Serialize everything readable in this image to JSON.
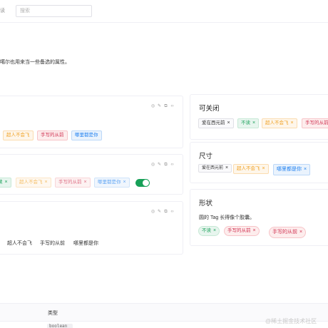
{
  "topbar": {
    "partial_text": "读",
    "search_placeholder": "搜索"
  },
  "intro": {
    "text": "噶尔也用来当一些备选的属性。"
  },
  "tags": {
    "never_fly": "超人不会飞",
    "handwritten_past": "手写的从前",
    "everywhere_you": "哪里都是你",
    "before_bc": "爱在西元前",
    "dont_read": "不该",
    "dont_read_short": "不读",
    "cut_e": "读"
  },
  "cards": {
    "closable": {
      "title": "可关闭"
    },
    "size": {
      "title": "尺寸"
    },
    "shape": {
      "title": "形状",
      "text": "圆的 Tag 长得像个胶囊。"
    }
  },
  "switch": {
    "checked": true,
    "color": "#18a058"
  },
  "table": {
    "header_type": "类型",
    "first_cell": "boolean"
  },
  "watermark": "@稀土掘金技术社区"
}
